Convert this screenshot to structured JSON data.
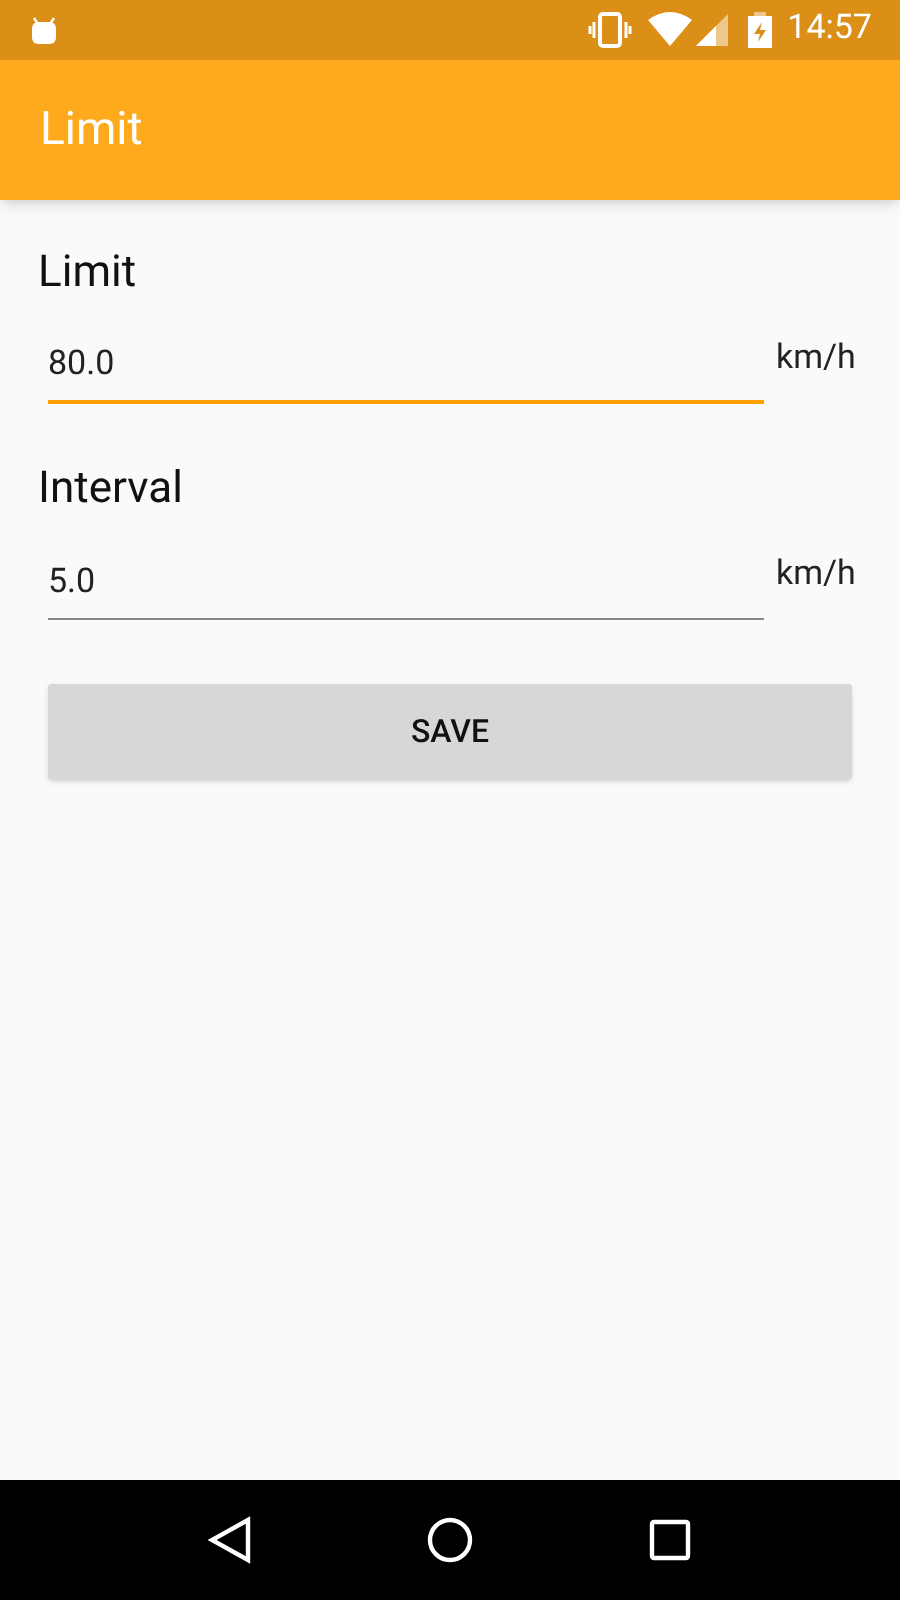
{
  "status_bar": {
    "time": "14:57"
  },
  "app_bar": {
    "title": "Limit"
  },
  "fields": [
    {
      "label": "Limit",
      "value": "80.0",
      "unit": "km/h",
      "focused": true
    },
    {
      "label": "Interval",
      "value": "5.0",
      "unit": "km/h",
      "focused": false
    }
  ],
  "button": {
    "label": "SAVE"
  }
}
